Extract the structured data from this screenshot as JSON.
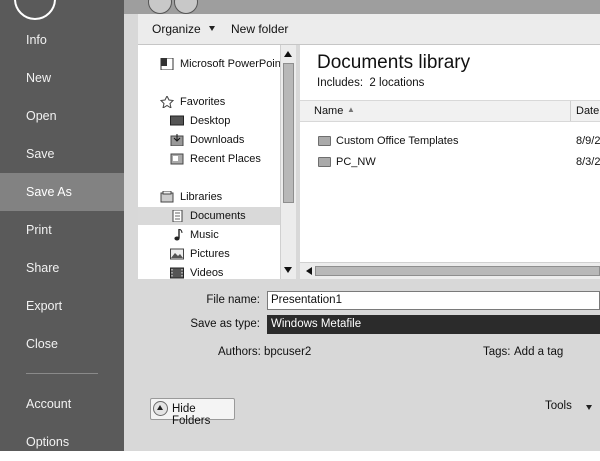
{
  "backstage": {
    "items": [
      {
        "label": "Info"
      },
      {
        "label": "New"
      },
      {
        "label": "Open"
      },
      {
        "label": "Save"
      },
      {
        "label": "Save As",
        "selected": true
      },
      {
        "label": "Print"
      },
      {
        "label": "Share"
      },
      {
        "label": "Export"
      },
      {
        "label": "Close"
      },
      {
        "label": "Account"
      },
      {
        "label": "Options"
      }
    ]
  },
  "toolbar": {
    "organize_label": "Organize",
    "new_folder_label": "New folder"
  },
  "nav_tree": {
    "items": [
      {
        "label": "Microsoft PowerPoint",
        "icon": "powerpoint-icon"
      },
      {
        "label": "Favorites",
        "icon": "star-icon"
      },
      {
        "label": "Desktop",
        "icon": "desktop-icon"
      },
      {
        "label": "Downloads",
        "icon": "downloads-icon"
      },
      {
        "label": "Recent Places",
        "icon": "recent-places-icon"
      },
      {
        "label": "Libraries",
        "icon": "libraries-icon"
      },
      {
        "label": "Documents",
        "icon": "documents-icon",
        "selected": true
      },
      {
        "label": "Music",
        "icon": "music-icon"
      },
      {
        "label": "Pictures",
        "icon": "pictures-icon"
      },
      {
        "label": "Videos",
        "icon": "videos-icon"
      }
    ]
  },
  "library": {
    "title": "Documents library",
    "includes_label": "Includes:",
    "includes_value": "2 locations"
  },
  "columns": {
    "name": "Name",
    "date": "Date"
  },
  "files": [
    {
      "name": "Custom Office Templates",
      "date": "8/9/2"
    },
    {
      "name": "PC_NW",
      "date": "8/3/2"
    }
  ],
  "form": {
    "file_name_label": "File name:",
    "file_name_value": "Presentation1",
    "save_type_label": "Save as type:",
    "save_type_value": "Windows Metafile",
    "authors_label": "Authors:",
    "authors_value": "bpcuser2",
    "tags_label": "Tags:",
    "tags_value": "Add a tag"
  },
  "footer": {
    "hide_folders_label": "Hide Folders",
    "tools_label": "Tools"
  },
  "colors": {
    "backstage_bg": "#5a5a5a",
    "backstage_selected": "#828282",
    "dialog_bg": "#d8d8d8"
  }
}
